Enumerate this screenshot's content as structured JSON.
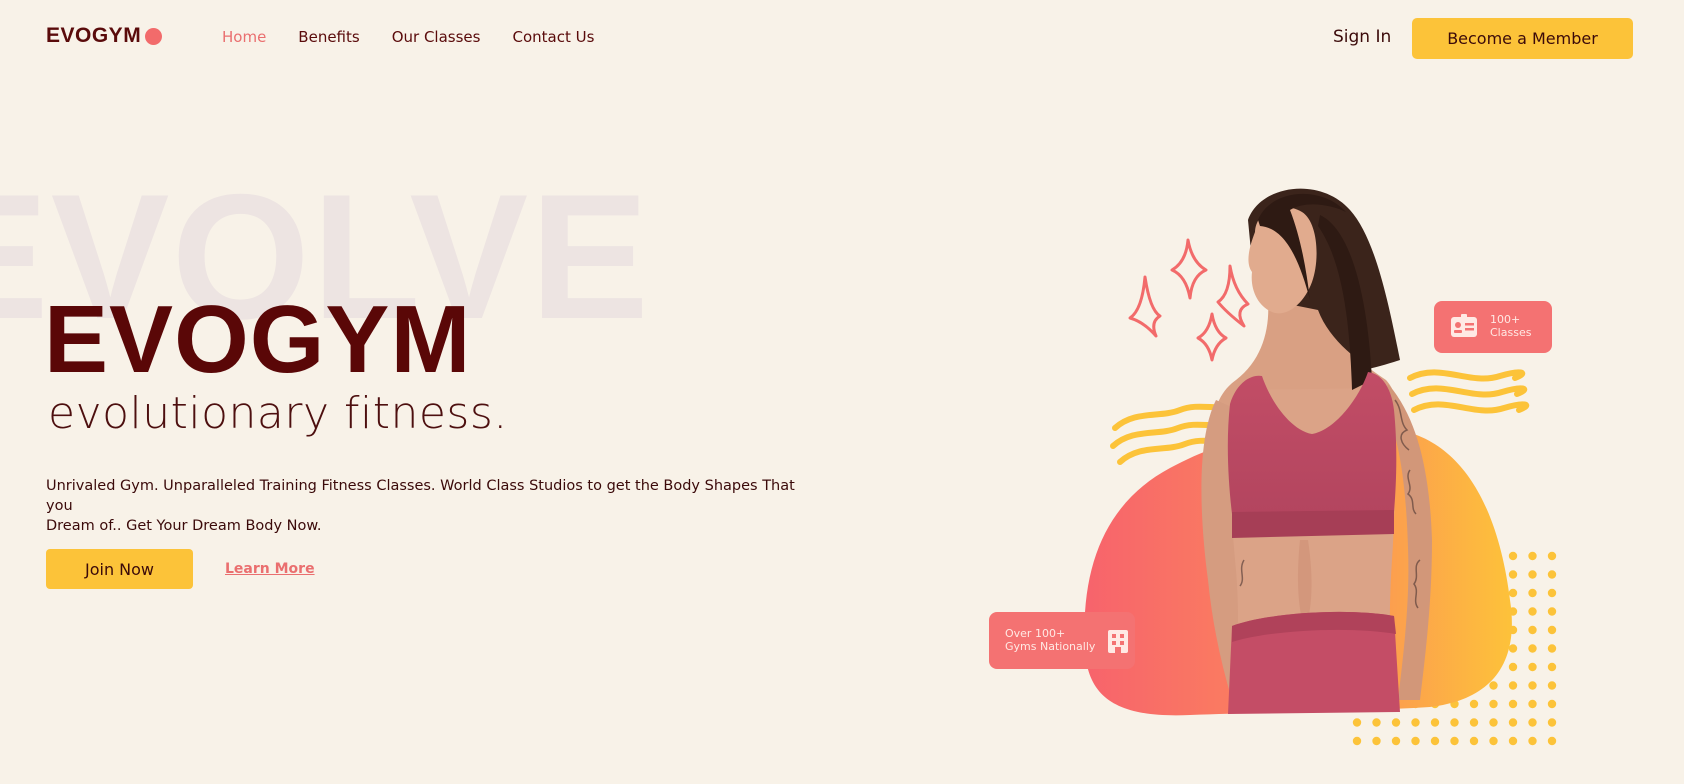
{
  "nav": {
    "logo": "EVOGYM",
    "links": [
      "Home",
      "Benefits",
      "Our Classes",
      "Contact Us"
    ],
    "active": "Home",
    "sign_in": "Sign In",
    "cta": "Become a Member"
  },
  "hero": {
    "background_word": "EVOLVE",
    "title": "EVOGYM",
    "subtitle": "evolutionary fitness.",
    "description_line1": "Unrivaled Gym. Unparalleled Training Fitness Classes. World Class Studios to get the Body Shapes That you",
    "description_line2": "Dream of.. Get Your Dream Body Now.",
    "join_label": "Join Now",
    "learn_label": "Learn More"
  },
  "badges": {
    "classes_line1": "100+",
    "classes_line2": "Classes",
    "classes_icon": "id-card-icon",
    "gyms_line1": "Over 100+",
    "gyms_line2": "Gyms Nationally",
    "gyms_icon": "building-icon"
  },
  "colors": {
    "background": "#f8f2e8",
    "primary_dark": "#5a0707",
    "accent_yellow": "#fcc339",
    "accent_coral": "#f47272"
  }
}
